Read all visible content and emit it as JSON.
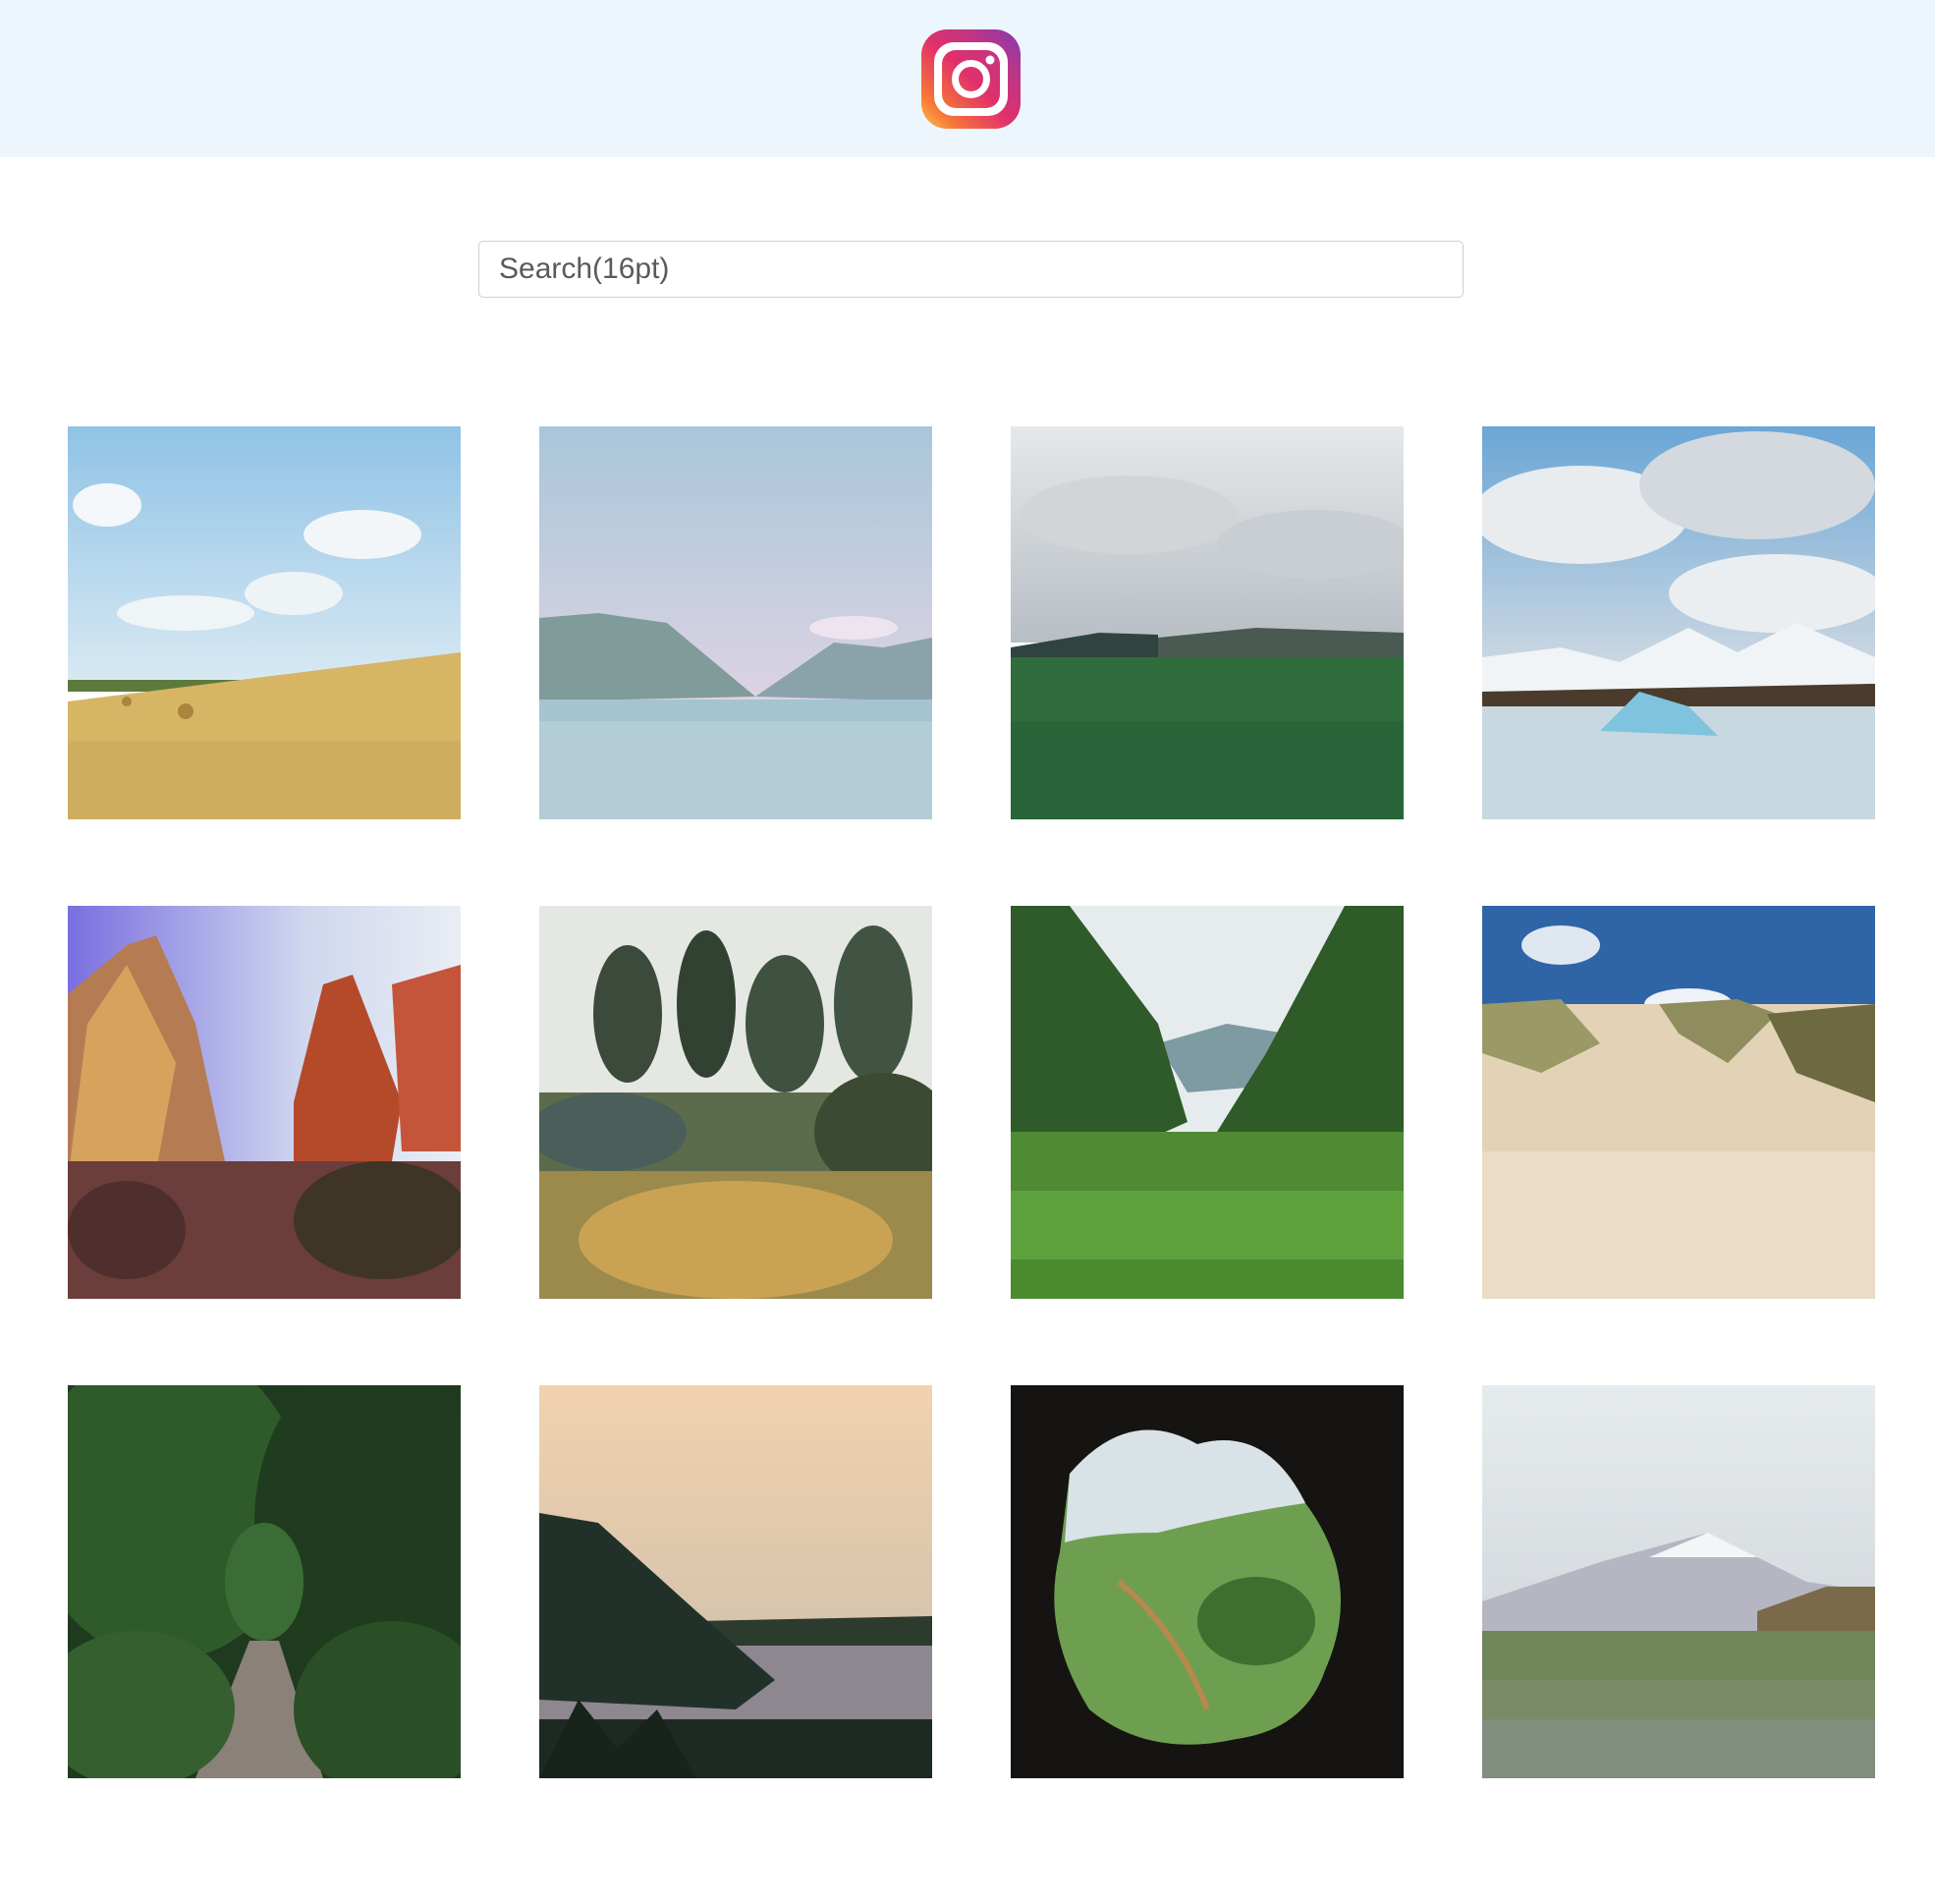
{
  "header": {
    "logo_icon": "instagram-logo-icon"
  },
  "search": {
    "placeholder": "Search(16pt)",
    "value": ""
  },
  "gallery": {
    "photos": [
      {
        "subject": "hay-field-photo"
      },
      {
        "subject": "mountain-lake-photo"
      },
      {
        "subject": "green-meadow-cliffs-photo"
      },
      {
        "subject": "glacier-lagoon-photo"
      },
      {
        "subject": "red-rock-canyon-photo"
      },
      {
        "subject": "forest-garden-photo"
      },
      {
        "subject": "green-valley-photo"
      },
      {
        "subject": "sand-dunes-photo"
      },
      {
        "subject": "forest-path-photo"
      },
      {
        "subject": "coastal-sunset-photo"
      },
      {
        "subject": "cave-view-valley-photo"
      },
      {
        "subject": "lupine-field-mountain-photo"
      }
    ]
  }
}
